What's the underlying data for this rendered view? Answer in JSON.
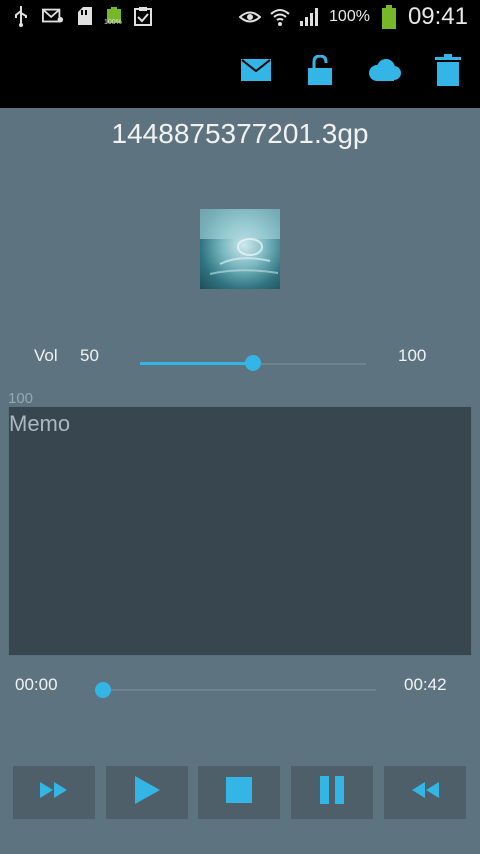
{
  "status_bar": {
    "battery_small_text": "100%",
    "battery_percent": "100%",
    "time": "09:41",
    "icons": [
      "usb-icon",
      "email-notify-icon",
      "sd-card-icon",
      "battery-full-icon",
      "clipboard-check-icon",
      "eye-icon",
      "wifi-icon",
      "signal-icon",
      "battery-icon"
    ]
  },
  "action_bar": {
    "icons": [
      "mail-icon",
      "unlock-icon",
      "cloud-icon",
      "trash-icon"
    ],
    "accent": "#33b5e5"
  },
  "file": {
    "name": "1448875377201.3gp"
  },
  "volume": {
    "label": "Vol",
    "value": "50",
    "max": "100",
    "level": 0.5
  },
  "memo": {
    "char_limit": "100",
    "placeholder": "Memo"
  },
  "playback": {
    "current": "00:00",
    "total": "00:42",
    "progress": 0
  },
  "controls": [
    "fast-forward-icon",
    "play-icon",
    "stop-icon",
    "pause-icon",
    "rewind-icon"
  ]
}
